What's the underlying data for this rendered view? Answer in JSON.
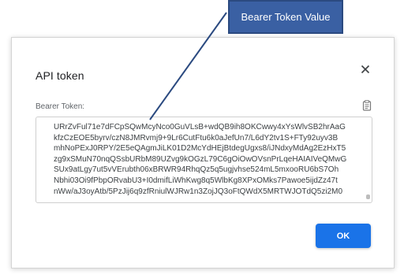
{
  "dialog": {
    "title": "API token",
    "field_label": "Bearer Token:",
    "ok_label": "OK",
    "accent_color": "#1a73e8",
    "icons": {
      "close": "close-icon",
      "copy": "copy-icon"
    }
  },
  "token": {
    "lines": [
      "URrZvFul71e7dFCpSQwMcyNco0GuVLsB+wdQB9ih8OKCwwy4xYsWlvSB2hrAaG",
      "kfzCzEOE5byrv/czN8JMRvmj9+9Lr6CutFtu6k0aJefUn7/L6dY2tv1S+FTy92uyv3B",
      "mhNoPExJ0RPY/2E5eQAgmJiLK01D2McYdHEjBtdegUgxs8/iJNdxyMdAg2EzHxT5",
      "zg9xSMuN70nqQSsbURbM89UZvg9kOGzL79C6gOiOwOVsnPrLqeHAIAIVeQMwG",
      "SUx9atLgy7ut5vVErubth06xBRWR94RhqQz5q5ugjvhse524mL5mxooRU6bS7Oh",
      "Nbhi03Oi9fPbpORvabU3+I0dmifLiWhKwg8q5WlbKg8XPxOMks7Pawoe5ijdZz47t",
      "nWw/aJ3oyAtb/5PzJij6q9zfRniulWJRw1n3ZojJQ3oFtQWdX5MRTWJOTdQ5zi2M0"
    ]
  },
  "annotation": {
    "label": "Bearer Token Value",
    "color": "#3a60a3"
  }
}
